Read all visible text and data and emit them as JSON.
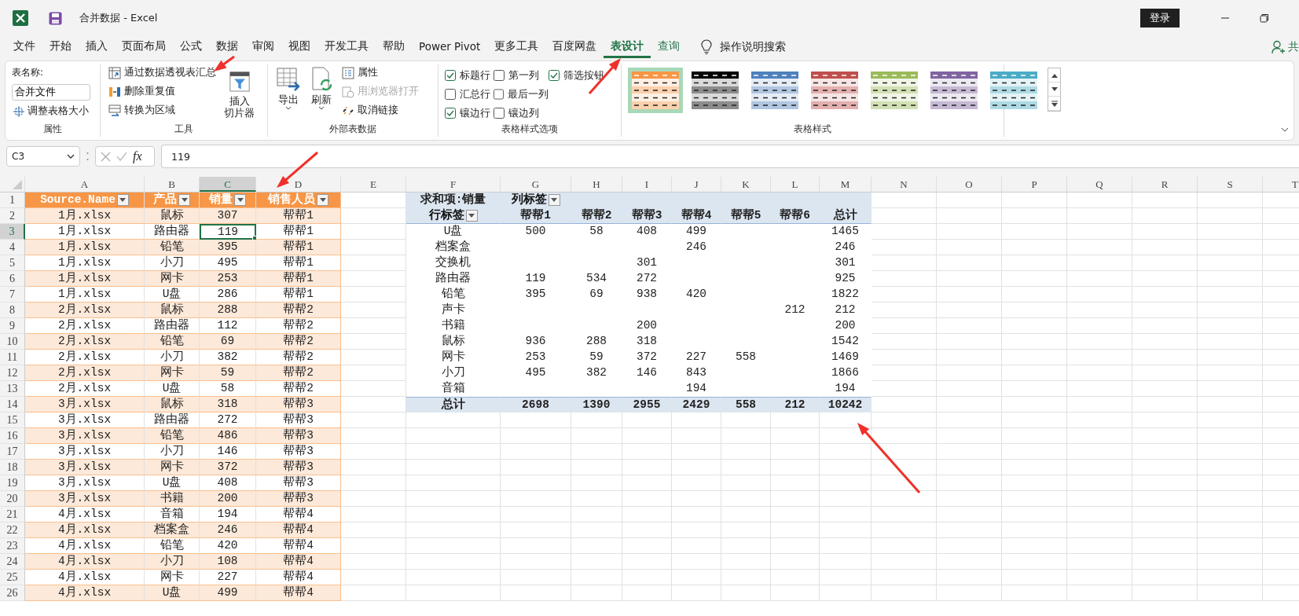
{
  "window": {
    "title": "合并数据  -  Excel",
    "login": "登录"
  },
  "tabs": [
    {
      "label": "文件",
      "selected": false,
      "contextual": false
    },
    {
      "label": "开始",
      "selected": false,
      "contextual": false
    },
    {
      "label": "插入",
      "selected": false,
      "contextual": false
    },
    {
      "label": "页面布局",
      "selected": false,
      "contextual": false
    },
    {
      "label": "公式",
      "selected": false,
      "contextual": false
    },
    {
      "label": "数据",
      "selected": false,
      "contextual": false
    },
    {
      "label": "审阅",
      "selected": false,
      "contextual": false
    },
    {
      "label": "视图",
      "selected": false,
      "contextual": false
    },
    {
      "label": "开发工具",
      "selected": false,
      "contextual": false
    },
    {
      "label": "帮助",
      "selected": false,
      "contextual": false
    },
    {
      "label": "Power Pivot",
      "selected": false,
      "contextual": false
    },
    {
      "label": "更多工具",
      "selected": false,
      "contextual": false
    },
    {
      "label": "百度网盘",
      "selected": false,
      "contextual": false
    },
    {
      "label": "表设计",
      "selected": true,
      "contextual": true
    },
    {
      "label": "查询",
      "selected": false,
      "contextual": true
    }
  ],
  "search": {
    "label": "操作说明搜索"
  },
  "share": {
    "label": "共"
  },
  "ribbon": {
    "properties": {
      "name_label": "表名称:",
      "name_value": "合并文件",
      "resize": "调整表格大小",
      "group": "属性"
    },
    "tools": {
      "items": [
        "通过数据透视表汇总",
        "删除重复值",
        "转换为区域"
      ],
      "slicer": [
        "插入",
        "切片器"
      ],
      "group": "工具"
    },
    "external": {
      "export": "导出",
      "refresh": "刷新",
      "items": [
        {
          "label": "属性",
          "disabled": false
        },
        {
          "label": "用浏览器打开",
          "disabled": true
        },
        {
          "label": "取消链接",
          "disabled": false
        }
      ],
      "group": "外部表数据"
    },
    "options": {
      "items": [
        {
          "label": "标题行",
          "checked": true
        },
        {
          "label": "第一列",
          "checked": false
        },
        {
          "label": "筛选按钮",
          "checked": true
        },
        {
          "label": "汇总行",
          "checked": false
        },
        {
          "label": "最后一列",
          "checked": false
        },
        {
          "label": "镶边行",
          "checked": true
        },
        {
          "label": "镶边列",
          "checked": false
        }
      ],
      "group": "表格样式选项"
    },
    "styles": {
      "items": [
        {
          "color": "#f79646",
          "selected": true
        },
        {
          "color": "#000000",
          "selected": false
        },
        {
          "color": "#4f81bd",
          "selected": false
        },
        {
          "color": "#c0504d",
          "selected": false
        },
        {
          "color": "#9bbb59",
          "selected": false
        },
        {
          "color": "#8064a2",
          "selected": false
        },
        {
          "color": "#4bacc6",
          "selected": false
        }
      ],
      "group": "表格样式"
    }
  },
  "formula_bar": {
    "name_box": "C3",
    "fx": "fx",
    "value": "119"
  },
  "sheet": {
    "column_headers": [
      {
        "label": "A",
        "selected": false
      },
      {
        "label": "B",
        "selected": false
      },
      {
        "label": "C",
        "selected": true
      },
      {
        "label": "D",
        "selected": false
      },
      {
        "label": "E",
        "selected": false
      },
      {
        "label": "F",
        "selected": false
      },
      {
        "label": "G",
        "selected": false
      },
      {
        "label": "H",
        "selected": false
      },
      {
        "label": "I",
        "selected": false
      },
      {
        "label": "J",
        "selected": false
      },
      {
        "label": "K",
        "selected": false
      },
      {
        "label": "L",
        "selected": false
      },
      {
        "label": "M",
        "selected": false
      },
      {
        "label": "N",
        "selected": false
      },
      {
        "label": "O",
        "selected": false
      },
      {
        "label": "P",
        "selected": false
      },
      {
        "label": "Q",
        "selected": false
      },
      {
        "label": "R",
        "selected": false
      },
      {
        "label": "S",
        "selected": false
      },
      {
        "label": "T",
        "selected": false
      }
    ],
    "row_numbers": [
      {
        "label": "1",
        "selected": false
      },
      {
        "label": "2",
        "selected": false
      },
      {
        "label": "3",
        "selected": true
      },
      {
        "label": "4",
        "selected": false
      },
      {
        "label": "5",
        "selected": false
      },
      {
        "label": "6",
        "selected": false
      },
      {
        "label": "7",
        "selected": false
      },
      {
        "label": "8",
        "selected": false
      },
      {
        "label": "9",
        "selected": false
      },
      {
        "label": "10",
        "selected": false
      },
      {
        "label": "11",
        "selected": false
      },
      {
        "label": "12",
        "selected": false
      },
      {
        "label": "13",
        "selected": false
      },
      {
        "label": "14",
        "selected": false
      },
      {
        "label": "15",
        "selected": false
      },
      {
        "label": "16",
        "selected": false
      },
      {
        "label": "17",
        "selected": false
      },
      {
        "label": "18",
        "selected": false
      },
      {
        "label": "19",
        "selected": false
      },
      {
        "label": "20",
        "selected": false
      },
      {
        "label": "21",
        "selected": false
      },
      {
        "label": "22",
        "selected": false
      },
      {
        "label": "23",
        "selected": false
      },
      {
        "label": "24",
        "selected": false
      },
      {
        "label": "25",
        "selected": false
      },
      {
        "label": "26",
        "selected": false
      }
    ]
  },
  "source_table": {
    "headers": [
      "Source.Name",
      "产品",
      "销量",
      "销售人员"
    ],
    "rows": [
      {
        "cells": [
          "1月.xlsx",
          "鼠标",
          "307",
          "帮帮1"
        ],
        "active": false
      },
      {
        "cells": [
          "1月.xlsx",
          "路由器",
          "119",
          "帮帮1"
        ],
        "active": true
      },
      {
        "cells": [
          "1月.xlsx",
          "铅笔",
          "395",
          "帮帮1"
        ],
        "active": false
      },
      {
        "cells": [
          "1月.xlsx",
          "小刀",
          "495",
          "帮帮1"
        ],
        "active": false
      },
      {
        "cells": [
          "1月.xlsx",
          "网卡",
          "253",
          "帮帮1"
        ],
        "active": false
      },
      {
        "cells": [
          "1月.xlsx",
          "U盘",
          "286",
          "帮帮1"
        ],
        "active": false
      },
      {
        "cells": [
          "2月.xlsx",
          "鼠标",
          "288",
          "帮帮2"
        ],
        "active": false
      },
      {
        "cells": [
          "2月.xlsx",
          "路由器",
          "112",
          "帮帮2"
        ],
        "active": false
      },
      {
        "cells": [
          "2月.xlsx",
          "铅笔",
          "69",
          "帮帮2"
        ],
        "active": false
      },
      {
        "cells": [
          "2月.xlsx",
          "小刀",
          "382",
          "帮帮2"
        ],
        "active": false
      },
      {
        "cells": [
          "2月.xlsx",
          "网卡",
          "59",
          "帮帮2"
        ],
        "active": false
      },
      {
        "cells": [
          "2月.xlsx",
          "U盘",
          "58",
          "帮帮2"
        ],
        "active": false
      },
      {
        "cells": [
          "3月.xlsx",
          "鼠标",
          "318",
          "帮帮3"
        ],
        "active": false
      },
      {
        "cells": [
          "3月.xlsx",
          "路由器",
          "272",
          "帮帮3"
        ],
        "active": false
      },
      {
        "cells": [
          "3月.xlsx",
          "铅笔",
          "486",
          "帮帮3"
        ],
        "active": false
      },
      {
        "cells": [
          "3月.xlsx",
          "小刀",
          "146",
          "帮帮3"
        ],
        "active": false
      },
      {
        "cells": [
          "3月.xlsx",
          "网卡",
          "372",
          "帮帮3"
        ],
        "active": false
      },
      {
        "cells": [
          "3月.xlsx",
          "U盘",
          "408",
          "帮帮3"
        ],
        "active": false
      },
      {
        "cells": [
          "3月.xlsx",
          "书籍",
          "200",
          "帮帮3"
        ],
        "active": false
      },
      {
        "cells": [
          "4月.xlsx",
          "音箱",
          "194",
          "帮帮4"
        ],
        "active": false
      },
      {
        "cells": [
          "4月.xlsx",
          "档案盒",
          "246",
          "帮帮4"
        ],
        "active": false
      },
      {
        "cells": [
          "4月.xlsx",
          "铅笔",
          "420",
          "帮帮4"
        ],
        "active": false
      },
      {
        "cells": [
          "4月.xlsx",
          "小刀",
          "108",
          "帮帮4"
        ],
        "active": false
      },
      {
        "cells": [
          "4月.xlsx",
          "网卡",
          "227",
          "帮帮4"
        ],
        "active": false
      },
      {
        "cells": [
          "4月.xlsx",
          "U盘",
          "499",
          "帮帮4"
        ],
        "active": false
      }
    ]
  },
  "pivot": {
    "corner": "求和项:销量",
    "column_label": "列标签",
    "row_label": "行标签",
    "columns": [
      "帮帮1",
      "帮帮2",
      "帮帮3",
      "帮帮4",
      "帮帮5",
      "帮帮6",
      "总计"
    ],
    "rows": [
      {
        "label": "U盘",
        "values": [
          {
            "kind": "value",
            "text": "500"
          },
          {
            "kind": "value",
            "text": "58"
          },
          {
            "kind": "value",
            "text": "408"
          },
          {
            "kind": "value",
            "text": "499"
          },
          {
            "kind": "blank"
          },
          {
            "kind": "blank"
          },
          {
            "kind": "value",
            "text": "1465"
          }
        ]
      },
      {
        "label": "档案盒",
        "values": [
          {
            "kind": "blank"
          },
          {
            "kind": "blank"
          },
          {
            "kind": "blank"
          },
          {
            "kind": "value",
            "text": "246"
          },
          {
            "kind": "blank"
          },
          {
            "kind": "blank"
          },
          {
            "kind": "value",
            "text": "246"
          }
        ]
      },
      {
        "label": "交换机",
        "values": [
          {
            "kind": "blank"
          },
          {
            "kind": "blank"
          },
          {
            "kind": "value",
            "text": "301"
          },
          {
            "kind": "blank"
          },
          {
            "kind": "blank"
          },
          {
            "kind": "blank"
          },
          {
            "kind": "value",
            "text": "301"
          }
        ]
      },
      {
        "label": "路由器",
        "values": [
          {
            "kind": "value",
            "text": "119"
          },
          {
            "kind": "value",
            "text": "534"
          },
          {
            "kind": "value",
            "text": "272"
          },
          {
            "kind": "blank"
          },
          {
            "kind": "blank"
          },
          {
            "kind": "blank"
          },
          {
            "kind": "value",
            "text": "925"
          }
        ]
      },
      {
        "label": "铅笔",
        "values": [
          {
            "kind": "value",
            "text": "395"
          },
          {
            "kind": "value",
            "text": "69"
          },
          {
            "kind": "value",
            "text": "938"
          },
          {
            "kind": "value",
            "text": "420"
          },
          {
            "kind": "blank"
          },
          {
            "kind": "blank"
          },
          {
            "kind": "value",
            "text": "1822"
          }
        ]
      },
      {
        "label": "声卡",
        "values": [
          {
            "kind": "blank"
          },
          {
            "kind": "blank"
          },
          {
            "kind": "blank"
          },
          {
            "kind": "blank"
          },
          {
            "kind": "blank"
          },
          {
            "kind": "value",
            "text": "212"
          },
          {
            "kind": "value",
            "text": "212"
          }
        ]
      },
      {
        "label": "书籍",
        "values": [
          {
            "kind": "blank"
          },
          {
            "kind": "blank"
          },
          {
            "kind": "value",
            "text": "200"
          },
          {
            "kind": "blank"
          },
          {
            "kind": "blank"
          },
          {
            "kind": "blank"
          },
          {
            "kind": "value",
            "text": "200"
          }
        ]
      },
      {
        "label": "鼠标",
        "values": [
          {
            "kind": "value",
            "text": "936"
          },
          {
            "kind": "value",
            "text": "288"
          },
          {
            "kind": "value",
            "text": "318"
          },
          {
            "kind": "blank"
          },
          {
            "kind": "blank"
          },
          {
            "kind": "blank"
          },
          {
            "kind": "value",
            "text": "1542"
          }
        ]
      },
      {
        "label": "网卡",
        "values": [
          {
            "kind": "value",
            "text": "253"
          },
          {
            "kind": "value",
            "text": "59"
          },
          {
            "kind": "value",
            "text": "372"
          },
          {
            "kind": "value",
            "text": "227"
          },
          {
            "kind": "value",
            "text": "558"
          },
          {
            "kind": "blank"
          },
          {
            "kind": "value",
            "text": "1469"
          }
        ]
      },
      {
        "label": "小刀",
        "values": [
          {
            "kind": "value",
            "text": "495"
          },
          {
            "kind": "value",
            "text": "382"
          },
          {
            "kind": "value",
            "text": "146"
          },
          {
            "kind": "value",
            "text": "843"
          },
          {
            "kind": "blank"
          },
          {
            "kind": "blank"
          },
          {
            "kind": "value",
            "text": "1866"
          }
        ]
      },
      {
        "label": "音箱",
        "values": [
          {
            "kind": "blank"
          },
          {
            "kind": "blank"
          },
          {
            "kind": "blank"
          },
          {
            "kind": "value",
            "text": "194"
          },
          {
            "kind": "blank"
          },
          {
            "kind": "blank"
          },
          {
            "kind": "value",
            "text": "194"
          }
        ]
      }
    ],
    "total": {
      "label": "总计",
      "values": [
        "2698",
        "1390",
        "2955",
        "2429",
        "558",
        "212",
        "10242"
      ]
    }
  }
}
